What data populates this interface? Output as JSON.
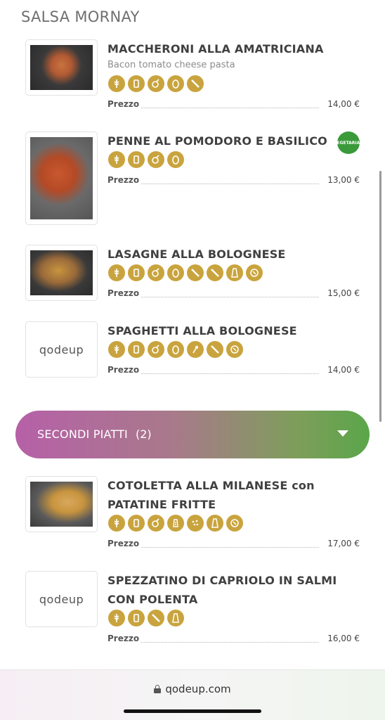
{
  "header": {
    "title": "SALSA MORNAY"
  },
  "items": [
    {
      "name": "MACCHERONI ALLA AMATRICIANA",
      "description": "Bacon tomato cheese pasta",
      "allergens": [
        "gluten-icon",
        "milk-icon",
        "nuts-icon",
        "egg-icon",
        "celery-icon"
      ],
      "price_label": "Prezzo",
      "price": "14,00 €"
    },
    {
      "name": "PENNE AL POMODORO E BASILICO",
      "badge": "VEGETARIAN",
      "allergens": [
        "gluten-icon",
        "milk-icon",
        "nuts-icon",
        "egg-icon"
      ],
      "price_label": "Prezzo",
      "price": "13,00 €"
    },
    {
      "name": "LASAGNE ALLA BOLOGNESE",
      "allergens": [
        "gluten-icon",
        "milk-icon",
        "nuts-icon",
        "egg-icon",
        "celery-icon",
        "celery-icon",
        "mustard-icon",
        "sulfites-icon"
      ],
      "price_label": "Prezzo",
      "price": "15,00 €"
    },
    {
      "name": "SPAGHETTI ALLA BOLOGNESE",
      "logo": "qodeup",
      "allergens": [
        "gluten-icon",
        "milk-icon",
        "nuts-icon",
        "egg-icon",
        "soy-icon",
        "celery-icon",
        "sulfites-icon"
      ],
      "price_label": "Prezzo",
      "price": "14,00 €"
    },
    {
      "name": "COTOLETTA ALLA MILANESE con PATATINE FRITTE",
      "allergens": [
        "gluten-icon",
        "milk-icon",
        "nuts-icon",
        "fish-icon",
        "sesame-icon",
        "mustard-icon",
        "sulfites-icon"
      ],
      "price_label": "Prezzo",
      "price": "17,00 €"
    },
    {
      "name": "SPEZZATINO DI CAPRIOLO IN SALMI CON POLENTA",
      "logo": "qodeup",
      "allergens": [
        "gluten-icon",
        "milk-icon",
        "celery-icon",
        "mustard-icon"
      ],
      "price_label": "Prezzo",
      "price": "16,00 €"
    }
  ],
  "category": {
    "label": "SECONDI PIATTI",
    "count": "(2)"
  },
  "browser": {
    "url": "qodeup.com"
  },
  "colors": {
    "allergen_gold": "#c9a43e",
    "gradient_left": "#b660a8",
    "gradient_right": "#5aa64a"
  }
}
